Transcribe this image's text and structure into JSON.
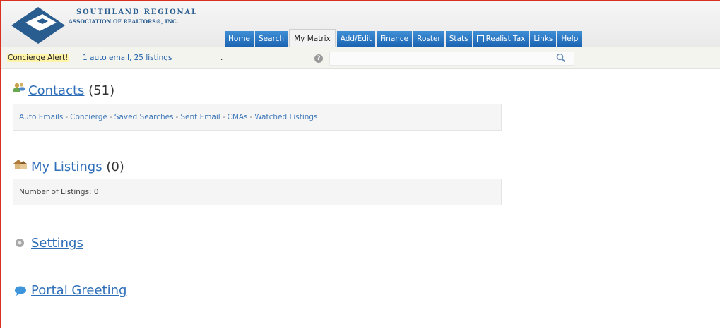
{
  "brand": {
    "line1": "SOUTHLAND REGIONAL",
    "line2": "ASSOCIATION OF REALTORS®, INC.",
    "color": "#2a5d8f"
  },
  "nav": {
    "tabs": [
      "Home",
      "Search",
      "My Matrix",
      "Add/Edit",
      "Finance",
      "Roster",
      "Stats",
      "Realist Tax",
      "Links",
      "Help"
    ],
    "active": "My Matrix",
    "tab_color": "#1c64b2"
  },
  "alert": {
    "label": "Concierge Alert!",
    "link": "1 auto email, 25 listings",
    "suffix": "."
  },
  "sections": {
    "contacts": {
      "title": "Contacts",
      "count": "(51)",
      "links": [
        "Auto Emails",
        "Concierge",
        "Saved Searches",
        "Sent Email",
        "CMAs",
        "Watched Listings"
      ],
      "separator": "-"
    },
    "listings": {
      "title": "My Listings",
      "count": "(0)",
      "info": "Number of Listings: 0"
    },
    "settings": {
      "title": "Settings"
    },
    "greeting": {
      "title": "Portal Greeting"
    }
  },
  "icons": {
    "contacts": "contacts-icon",
    "listings": "houses-icon",
    "settings": "gear-icon",
    "greeting": "speech-bubble-icon",
    "help": "help-icon",
    "search": "search-icon",
    "realist": "realist-icon"
  }
}
